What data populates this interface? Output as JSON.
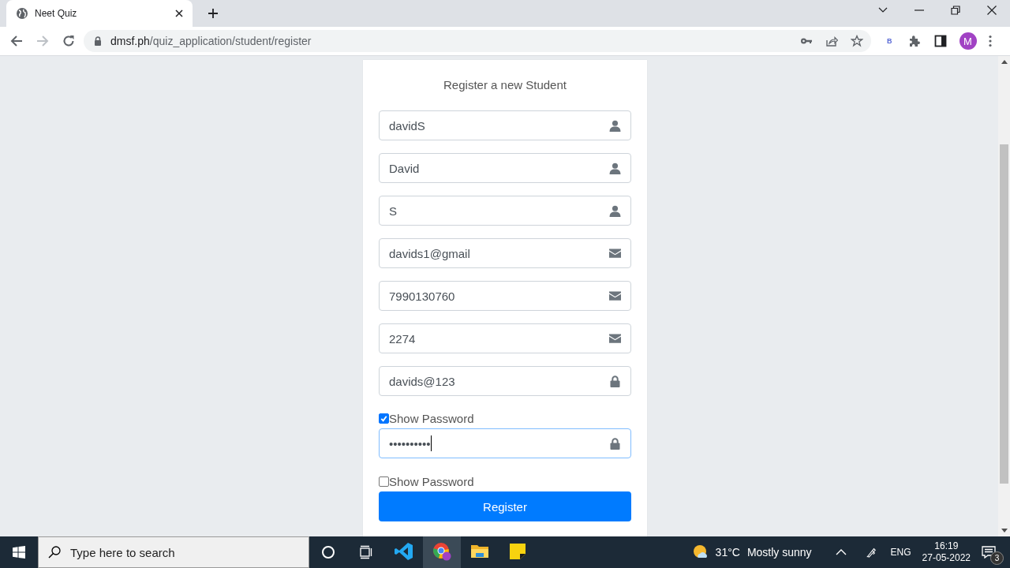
{
  "browser": {
    "tab": {
      "title": "Neet Quiz",
      "selected": true
    },
    "address": {
      "host": "dmsf.ph",
      "path": "/quiz_application/student/register"
    },
    "extension_label": "B",
    "profile_initial": "M"
  },
  "form": {
    "title": "Register a new Student",
    "fields": [
      {
        "kind": "user",
        "value": "davidS",
        "focused": false
      },
      {
        "kind": "user",
        "value": "David",
        "focused": false
      },
      {
        "kind": "user",
        "value": "S",
        "focused": false
      },
      {
        "kind": "mail",
        "value": "davids1@gmail",
        "focused": false
      },
      {
        "kind": "mail",
        "value": "7990130760",
        "focused": false
      },
      {
        "kind": "mail",
        "value": "2274",
        "focused": false
      },
      {
        "kind": "password",
        "value": "davids@123",
        "focused": false
      },
      {
        "kind": "checkbox",
        "label": "Show Password",
        "checked": true
      },
      {
        "kind": "password",
        "value": "••••••••••",
        "focused": true
      },
      {
        "kind": "checkbox",
        "label": "Show Password",
        "checked": false
      }
    ],
    "submit": "Register"
  },
  "taskbar": {
    "search_placeholder": "Type here to search",
    "temperature": "31°C",
    "weather": "Mostly sunny",
    "language": "ENG",
    "time": "16:19",
    "date": "27-05-2022",
    "notifications": "3"
  }
}
